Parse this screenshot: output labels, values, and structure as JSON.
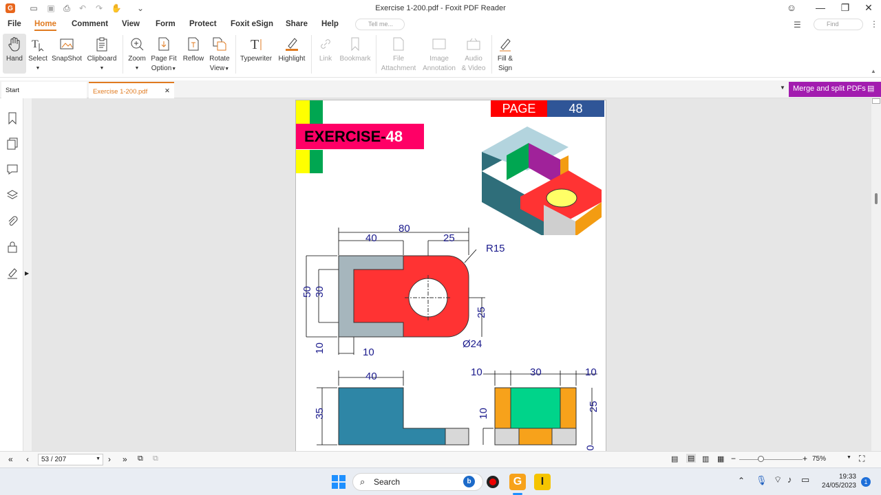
{
  "window": {
    "title": "Exercise 1-200.pdf - Foxit PDF Reader"
  },
  "menu": {
    "items": [
      "File",
      "Home",
      "Comment",
      "View",
      "Form",
      "Protect",
      "Foxit eSign",
      "Share",
      "Help"
    ],
    "tell_me": "Tell me...",
    "find": "Find"
  },
  "ribbon": {
    "hand": "Hand",
    "select": "Select",
    "snapshot": "SnapShot",
    "clipboard": "Clipboard",
    "zoom": "Zoom",
    "page_fit": "Page Fit",
    "page_fit2": "Option",
    "reflow": "Reflow",
    "rotate": "Rotate",
    "rotate2": "View",
    "typewriter": "Typewriter",
    "highlight": "Highlight",
    "link": "Link",
    "bookmark": "Bookmark",
    "file_att": "File",
    "file_att2": "Attachment",
    "image_ann": "Image",
    "image_ann2": "Annotation",
    "audio": "Audio",
    "audio2": "& Video",
    "fill": "Fill &",
    "fill2": "Sign"
  },
  "tabs": {
    "start": "Start",
    "file": "Exercise 1-200.pdf",
    "merge": "Merge and split PDFs"
  },
  "page_content": {
    "page_label": "PAGE",
    "page_num": "48",
    "exercise": "EXERCISE-",
    "exercise_num": "48",
    "dims": {
      "d80": "80",
      "d40": "40",
      "d25": "25",
      "r15": "R15",
      "d50": "50",
      "d30": "30",
      "d25b": "25",
      "dia24": "Ø24",
      "d10a": "10",
      "d10b": "10",
      "f40": "40",
      "f35": "35",
      "s10a": "10",
      "s30": "30",
      "s10b": "10",
      "s25": "25",
      "s10c": "10",
      "s0": "0"
    }
  },
  "status": {
    "page": "53 / 207",
    "zoom": "75%"
  },
  "taskbar": {
    "search": "Search",
    "time": "19:33",
    "date": "24/05/2023",
    "badge": "1"
  },
  "colors": {
    "accent": "#e07a1f",
    "merge": "#a21caf",
    "red": "#ff3333",
    "blue": "#2f5597",
    "pink": "#ff0066"
  }
}
